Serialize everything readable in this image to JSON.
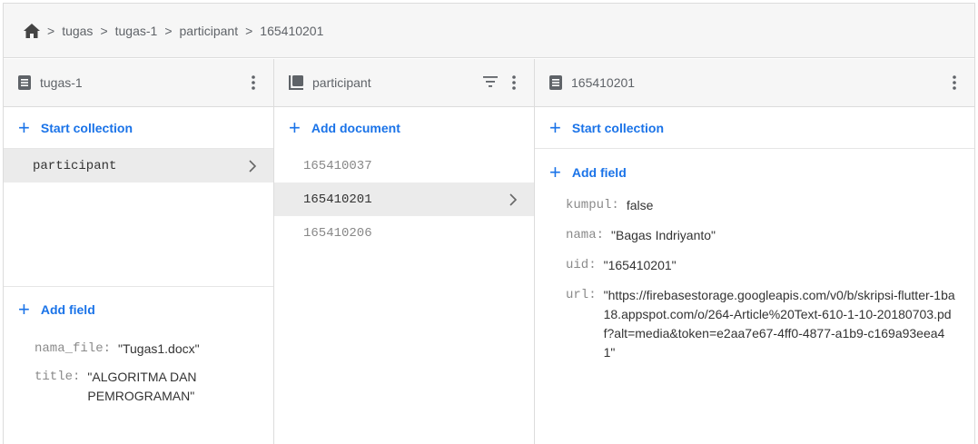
{
  "breadcrumb": {
    "home_icon": "home-icon",
    "items": [
      "tugas",
      "tugas-1",
      "participant",
      "165410201"
    ]
  },
  "panel1": {
    "title": "tugas-1",
    "action": "Start collection",
    "collections": [
      {
        "label": "participant",
        "selected": true
      }
    ],
    "add_field": "Add field",
    "fields": [
      {
        "key": "nama_file:",
        "value": "\"Tugas1.docx\""
      },
      {
        "key": "title:",
        "value": "\"ALGORITMA DAN PEMROGRAMAN\""
      }
    ]
  },
  "panel2": {
    "title": "participant",
    "action": "Add document",
    "documents": [
      {
        "label": "165410037",
        "selected": false
      },
      {
        "label": "165410201",
        "selected": true
      },
      {
        "label": "165410206",
        "selected": false
      }
    ]
  },
  "panel3": {
    "title": "165410201",
    "action": "Start collection",
    "add_field": "Add field",
    "fields": [
      {
        "key": "kumpul:",
        "value": "false"
      },
      {
        "key": "nama:",
        "value": "\"Bagas Indriyanto\""
      },
      {
        "key": "uid:",
        "value": "\"165410201\""
      },
      {
        "key": "url:",
        "value": "\"https://firebasestorage.googleapis.com/v0/b/skripsi-flutter-1ba18.appspot.com/o/264-Article%20Text-610-1-10-20180703.pdf?alt=media&token=e2aa7e67-4ff0-4877-a1b9-c169a93eea41\""
      }
    ]
  },
  "colors": {
    "accent": "#1a73e8",
    "header_bg": "#f6f6f6",
    "selected_bg": "#ebebeb"
  }
}
